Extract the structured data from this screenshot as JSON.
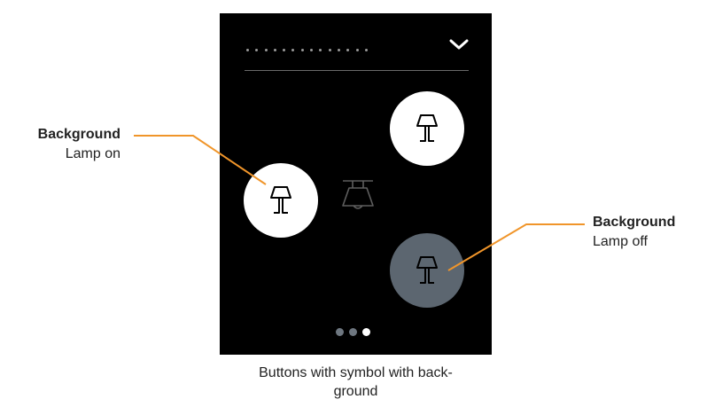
{
  "callouts": {
    "left": {
      "title": "Background",
      "subtitle": "Lamp on"
    },
    "right": {
      "title": "Background",
      "subtitle": "Lamp off"
    }
  },
  "caption": "Buttons with symbol with back-\nground",
  "caption_line1": "Buttons with symbol with back-",
  "caption_line2": "ground",
  "colors": {
    "screen_bg": "#000000",
    "lamp_on_bg": "#ffffff",
    "lamp_off_bg": "#5c6670",
    "callout_line": "#f0952a",
    "pager_active": "#ffffff",
    "pager_inactive": "#6e7780"
  },
  "header": {
    "title_dots": 14,
    "menu_icon": "chevron-down-icon"
  },
  "buttons": [
    {
      "id": "top-right",
      "state": "on",
      "icon": "lamp-icon"
    },
    {
      "id": "left",
      "state": "on",
      "icon": "lamp-icon"
    },
    {
      "id": "bottom-right",
      "state": "off",
      "icon": "lamp-icon"
    }
  ],
  "center_icon": "ceiling-lamp-icon",
  "pager": {
    "pages": 3,
    "active": 3
  }
}
